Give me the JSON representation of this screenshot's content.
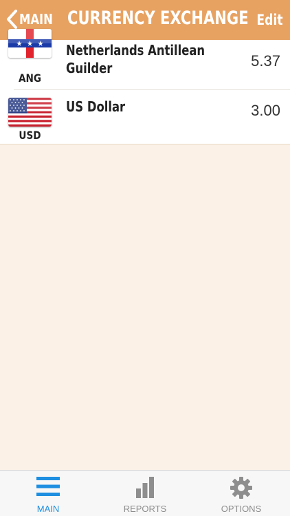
{
  "header": {
    "back_label": "MAIN",
    "title": "CURRENCY EXCHANGE",
    "edit_label": "Edit"
  },
  "currencies": [
    {
      "code": "ANG",
      "name_line1": "Netherlands Antillean",
      "name_line2": "Guilder",
      "amount": "5.37",
      "flag_icon": "netherlands-antilles-flag-icon"
    },
    {
      "code": "USD",
      "name_line1": "US Dollar",
      "name_line2": "",
      "amount": "3.00",
      "flag_icon": "us-flag-icon"
    }
  ],
  "tabs": [
    {
      "label": "MAIN",
      "icon": "menu-icon",
      "active": true
    },
    {
      "label": "REPORTS",
      "icon": "bar-chart-icon",
      "active": false
    },
    {
      "label": "OPTIONS",
      "icon": "gear-icon",
      "active": false
    }
  ],
  "colors": {
    "header_bg": "#e7a262",
    "page_bg": "#fbf1e7",
    "tab_active": "#1e8fe1",
    "tab_inactive": "#8e8e8e"
  }
}
